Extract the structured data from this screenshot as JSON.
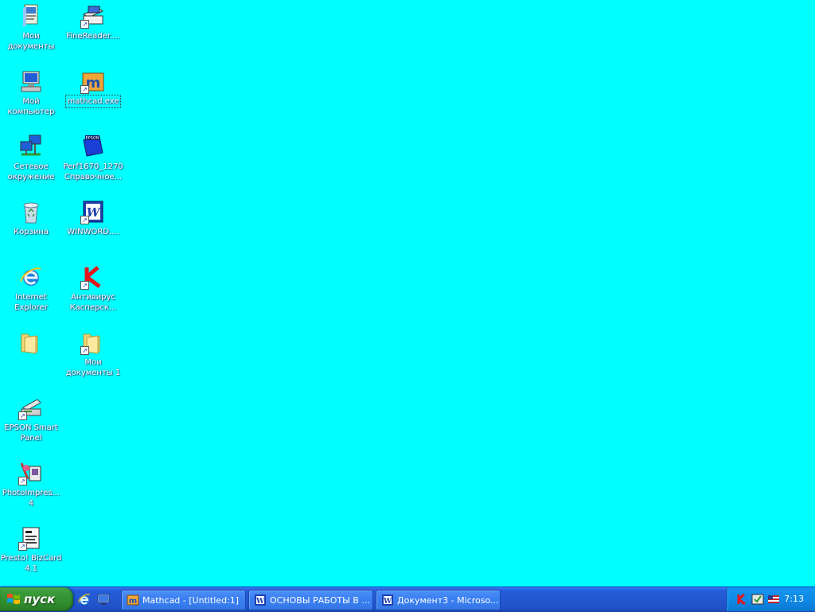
{
  "desktop": {
    "background_color": "#00FFFF",
    "icons": [
      {
        "label": "Мои\nдокументы",
        "icon": "my-documents-icon"
      },
      {
        "label": "FineReader....",
        "icon": "finereader-icon"
      },
      {
        "label": "Мой\nкомпьютер",
        "icon": "my-computer-icon"
      },
      {
        "label": "mathcad.exe",
        "icon": "mathcad-icon",
        "selected": true
      },
      {
        "label": "Сетевое\nокружение",
        "icon": "network-places-icon"
      },
      {
        "label": "Perf1670_1270\nСправочное...",
        "icon": "epson-manual-icon"
      },
      {
        "label": "Корзина",
        "icon": "recycle-bin-icon"
      },
      {
        "label": "WINWORD....",
        "icon": "word-icon"
      },
      {
        "label": "Internet\nExplorer",
        "icon": "internet-explorer-icon"
      },
      {
        "label": "Антивирус\nКасперск...",
        "icon": "kaspersky-icon"
      },
      {
        "label": "",
        "icon": "folder-icon"
      },
      {
        "label": "Мои\nдокументы 1",
        "icon": "folder-shortcut-icon"
      },
      {
        "label": "EPSON Smart\nPanel",
        "icon": "epson-smart-panel-icon"
      },
      {
        "label": "PhotoImpres...\n4",
        "icon": "photoimpression-icon"
      },
      {
        "label": "Presto! BizCard\n4.1",
        "icon": "bizcard-icon"
      }
    ]
  },
  "taskbar": {
    "start_label": "пуск",
    "quicklaunch": [
      "internet-explorer-icon",
      "show-desktop-icon"
    ],
    "tasks": [
      {
        "label": "Mathcad - [Untitled:1]",
        "icon": "mathcad-icon"
      },
      {
        "label": "ОСНОВЫ РАБОТЫ В ...",
        "icon": "word-icon"
      },
      {
        "label": "Документ3 - Microso...",
        "icon": "word-icon"
      }
    ],
    "tray": {
      "icons": [
        "kaspersky-icon",
        "security-icon",
        "language-flag-icon"
      ],
      "clock": "7:13"
    }
  }
}
